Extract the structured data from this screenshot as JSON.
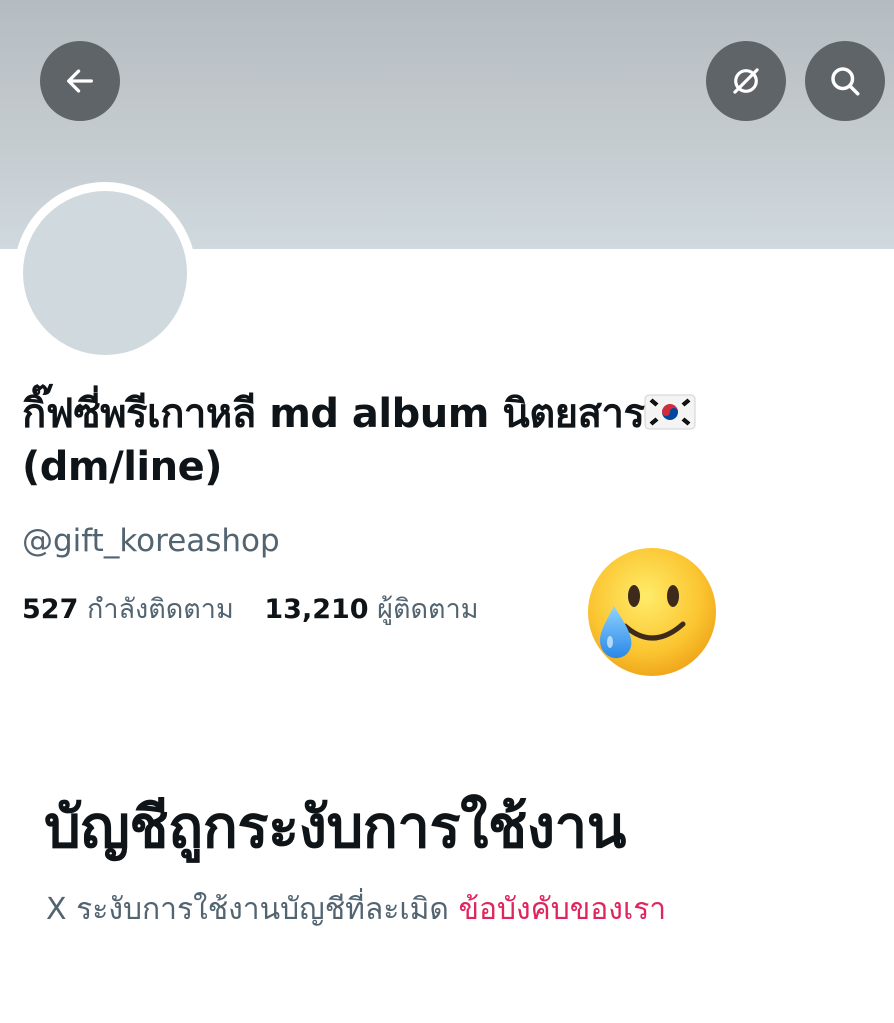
{
  "header": {
    "back_icon": "arrow-left-icon",
    "translate_icon": "eye-slash-icon",
    "search_icon": "search-icon"
  },
  "profile": {
    "display_name": "กิ๊ฟซี่พรีเกาหลี md album นิตยสาร",
    "display_name_line2": "(dm/line)",
    "flag_emoji": "korea-flag-icon",
    "handle": "@gift_koreashop",
    "following_count": "527",
    "following_label": "กำลังติดตาม",
    "followers_count": "13,210",
    "followers_label": "ผู้ติดตาม"
  },
  "overlay": {
    "emoji": "smiling-face-with-tear-emoji"
  },
  "suspension": {
    "title": "บัญชีถูกระงับการใช้งาน",
    "message": "X ระงับการใช้งานบัญชีที่ละเมิด ",
    "link_text": "ข้อบังคับของเรา"
  },
  "colors": {
    "banner": "#cfd9de",
    "link": "#e0245e",
    "secondary_text": "#536471",
    "button_bg": "#5f6468"
  }
}
